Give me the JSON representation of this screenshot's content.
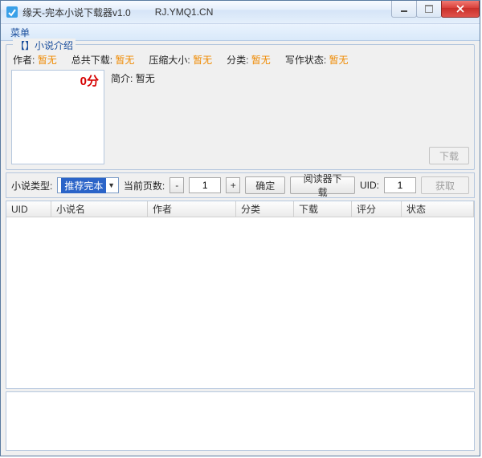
{
  "window": {
    "title": "缘天-完本小说下载器v1.0",
    "url": "RJ.YMQ1.CN"
  },
  "menu": {
    "main": "菜单"
  },
  "intro": {
    "group_title": "【】小说介绍",
    "author_label": "作者:",
    "author_value": "暂无",
    "downloads_label": "总共下载:",
    "downloads_value": "暂无",
    "size_label": "压缩大小:",
    "size_value": "暂无",
    "category_label": "分类:",
    "category_value": "暂无",
    "status_label": "写作状态:",
    "status_value": "暂无",
    "score": "0分",
    "summary_label": "简介:",
    "summary_value": "暂无",
    "download_btn": "下载"
  },
  "filter": {
    "type_label": "小说类型:",
    "type_selected": "推荐完本",
    "page_label": "当前页数:",
    "page_minus": "-",
    "page_value": "1",
    "page_plus": "+",
    "confirm_btn": "确定",
    "reader_dl_btn": "阅读器下载",
    "uid_label": "UID:",
    "uid_value": "1",
    "fetch_btn": "获取"
  },
  "columns": {
    "uid": "UID",
    "name": "小说名",
    "author": "作者",
    "category": "分类",
    "downloads": "下载",
    "rating": "评分",
    "status": "状态"
  }
}
